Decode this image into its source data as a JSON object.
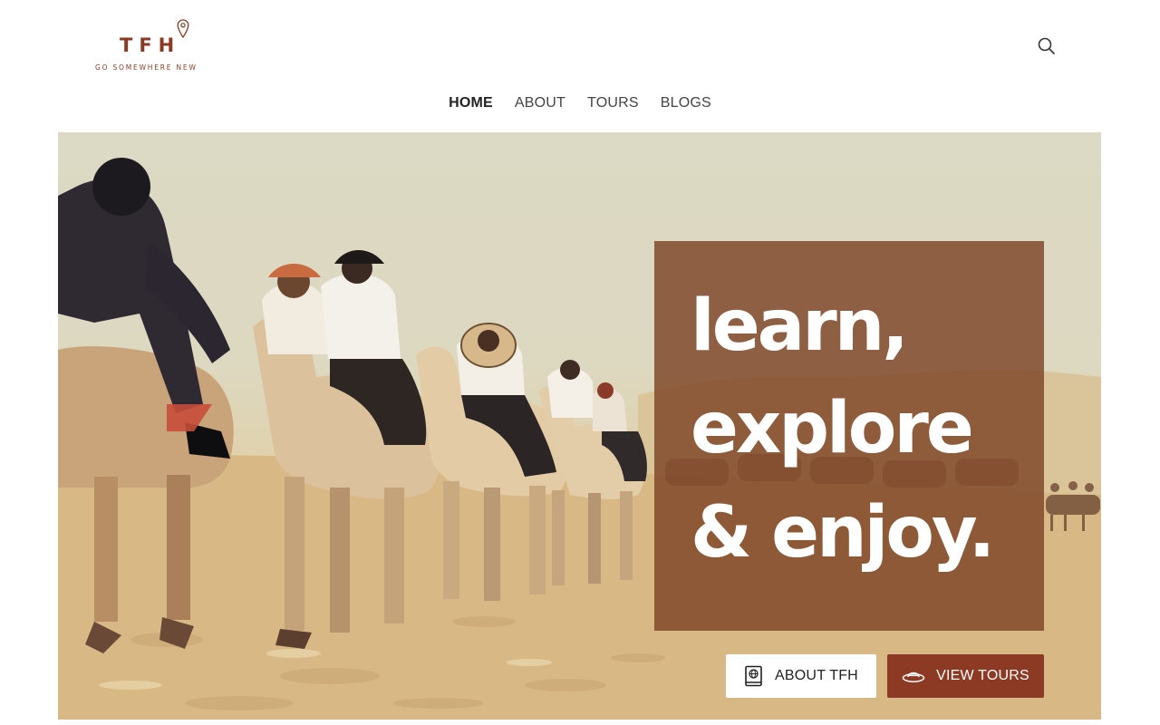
{
  "brand": {
    "logo_text": "TFH",
    "tagline": "GO SOMEWHERE NEW",
    "accent_color": "#8a3a22"
  },
  "header": {
    "search_icon": "search-icon"
  },
  "nav": {
    "items": [
      {
        "label": "HOME",
        "active": true
      },
      {
        "label": "ABOUT",
        "active": false
      },
      {
        "label": "TOURS",
        "active": false
      },
      {
        "label": "BLOGS",
        "active": false
      }
    ]
  },
  "hero": {
    "headline_lines": [
      "learn,",
      "explore",
      "& enjoy."
    ],
    "overlay_color": "#7c4426",
    "buttons": {
      "about_label": "ABOUT TFH",
      "about_icon": "passport-book-icon",
      "tours_label": "VIEW TOURS",
      "tours_icon": "hat-icon",
      "tours_color": "#8c3a23"
    }
  }
}
